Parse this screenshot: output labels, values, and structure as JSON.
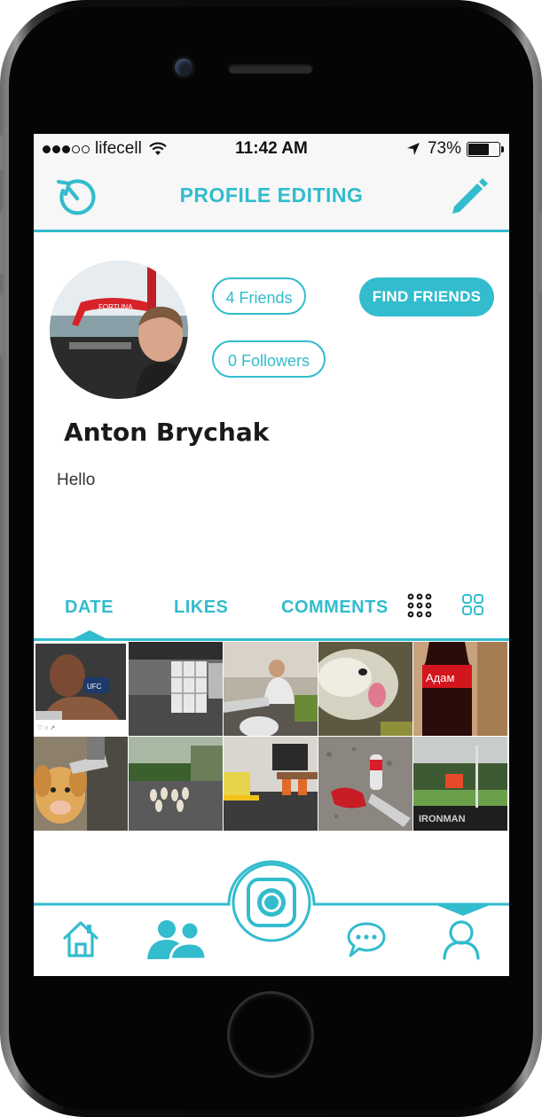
{
  "status_bar": {
    "carrier": "lifecell",
    "signal_dots_filled": 3,
    "signal_dots_total": 5,
    "time": "11:42 AM",
    "battery_percent": "73%",
    "battery_level": 0.73
  },
  "navbar": {
    "title": "PROFILE EDITING",
    "left_icon": "history-clock-icon",
    "right_icon": "pencil-edit-icon"
  },
  "profile": {
    "name": "Anton Brychak",
    "bio": "Hello",
    "friends_label": "4 Friends",
    "followers_label": "0 Followers",
    "find_friends_label": "FIND FRIENDS"
  },
  "tabs": {
    "items": [
      "DATE",
      "LIKES",
      "COMMENTS"
    ],
    "selected": "DATE",
    "view_icons": [
      "grid-dense-icon",
      "grid-large-icon"
    ]
  },
  "photos": [
    {
      "subject": "fighter-photo"
    },
    {
      "subject": "office-room-photo"
    },
    {
      "subject": "person-relaxing-photo"
    },
    {
      "subject": "dog-closeup-photo"
    },
    {
      "subject": "cola-bottle-photo",
      "label_text": "Адам"
    },
    {
      "subject": "golden-dog-photo"
    },
    {
      "subject": "garden-bowling-photo"
    },
    {
      "subject": "office-kitchen-photo"
    },
    {
      "subject": "gravel-bottles-photo"
    },
    {
      "subject": "race-finish-photo"
    }
  ],
  "bottom_nav": {
    "items": [
      "home-icon",
      "friends-icon",
      "camera-icon",
      "chat-icon",
      "profile-icon"
    ],
    "selected": "profile-icon"
  },
  "colors": {
    "accent": "#32bccd",
    "navbar_bg": "#f7f7f7",
    "text_dark": "#1a1a1a"
  }
}
